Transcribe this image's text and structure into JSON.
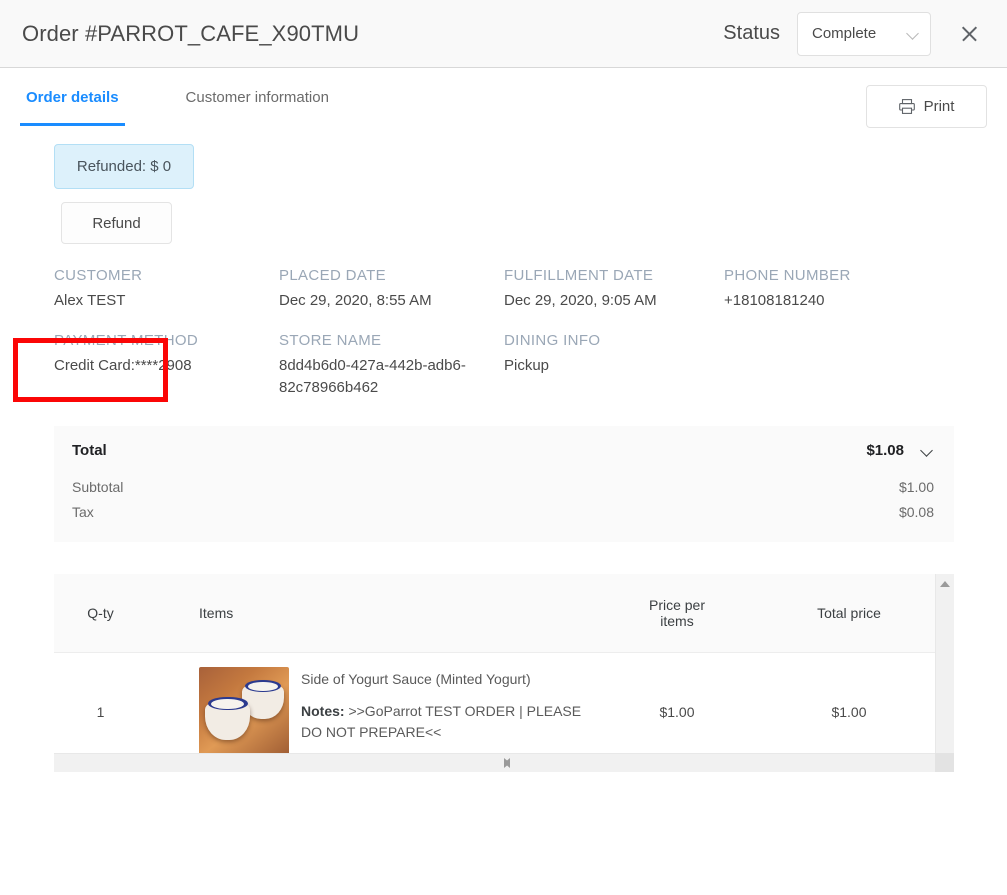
{
  "header": {
    "title": "Order #PARROT_CAFE_X90TMU",
    "status_label": "Status",
    "status_value": "Complete",
    "status_options": [
      "Complete"
    ],
    "close_label": "×"
  },
  "tabs": [
    {
      "label": "Order details",
      "active": true
    },
    {
      "label": "Customer information",
      "active": false
    }
  ],
  "toolbar": {
    "print_label": "Print"
  },
  "refund": {
    "badge_label": "Refunded: $ 0",
    "button_label": "Refund"
  },
  "info": [
    {
      "label": "CUSTOMER",
      "value": "Alex TEST"
    },
    {
      "label": "PLACED DATE",
      "value": "Dec 29, 2020, 8:55 AM"
    },
    {
      "label": "FULFILLMENT DATE",
      "value": "Dec 29, 2020, 9:05 AM"
    },
    {
      "label": "PHONE NUMBER",
      "value": "+18108181240"
    },
    {
      "label": "PAYMENT METHOD",
      "value": "Credit Card:****2908"
    },
    {
      "label": "STORE NAME",
      "value": "8dd4b6d0-427a-442b-adb6-82c78966b462"
    },
    {
      "label": "DINING INFO",
      "value": "Pickup"
    },
    {
      "label": "",
      "value": ""
    }
  ],
  "totals": {
    "total_label": "Total",
    "total_amount": "$1.08",
    "rows": [
      {
        "label": "Subtotal",
        "amount": "$1.00"
      },
      {
        "label": "Tax",
        "amount": "$0.08"
      }
    ]
  },
  "items_table": {
    "columns": [
      "Q-ty",
      "Items",
      "Price per items",
      "Total price"
    ],
    "rows": [
      {
        "qty": "1",
        "name": "Side of Yogurt Sauce (Minted Yogurt)",
        "notes_label": "Notes:",
        "notes_text": " >>GoParrot TEST ORDER | PLEASE DO NOT PREPARE<<",
        "price": "$1.00",
        "total": "$1.00"
      }
    ]
  },
  "colors": {
    "accent_blue": "#1a8cff",
    "badge_bg": "#ddf1fb",
    "badge_border": "#b3dff5",
    "highlight_red": "#fb0606",
    "label_muted": "#9aa7b6",
    "panel_bg": "#fafafa"
  }
}
